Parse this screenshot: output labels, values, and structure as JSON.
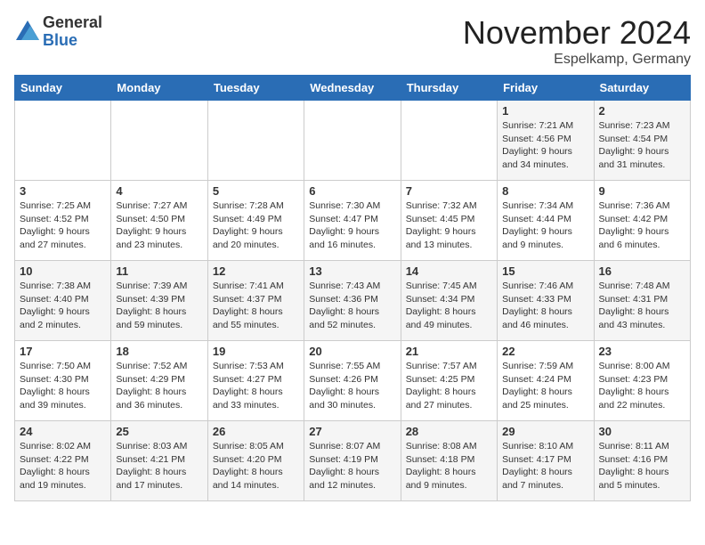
{
  "logo": {
    "general": "General",
    "blue": "Blue"
  },
  "title": "November 2024",
  "location": "Espelkamp, Germany",
  "headers": [
    "Sunday",
    "Monday",
    "Tuesday",
    "Wednesday",
    "Thursday",
    "Friday",
    "Saturday"
  ],
  "weeks": [
    [
      {
        "day": "",
        "info": ""
      },
      {
        "day": "",
        "info": ""
      },
      {
        "day": "",
        "info": ""
      },
      {
        "day": "",
        "info": ""
      },
      {
        "day": "",
        "info": ""
      },
      {
        "day": "1",
        "info": "Sunrise: 7:21 AM\nSunset: 4:56 PM\nDaylight: 9 hours\nand 34 minutes."
      },
      {
        "day": "2",
        "info": "Sunrise: 7:23 AM\nSunset: 4:54 PM\nDaylight: 9 hours\nand 31 minutes."
      }
    ],
    [
      {
        "day": "3",
        "info": "Sunrise: 7:25 AM\nSunset: 4:52 PM\nDaylight: 9 hours\nand 27 minutes."
      },
      {
        "day": "4",
        "info": "Sunrise: 7:27 AM\nSunset: 4:50 PM\nDaylight: 9 hours\nand 23 minutes."
      },
      {
        "day": "5",
        "info": "Sunrise: 7:28 AM\nSunset: 4:49 PM\nDaylight: 9 hours\nand 20 minutes."
      },
      {
        "day": "6",
        "info": "Sunrise: 7:30 AM\nSunset: 4:47 PM\nDaylight: 9 hours\nand 16 minutes."
      },
      {
        "day": "7",
        "info": "Sunrise: 7:32 AM\nSunset: 4:45 PM\nDaylight: 9 hours\nand 13 minutes."
      },
      {
        "day": "8",
        "info": "Sunrise: 7:34 AM\nSunset: 4:44 PM\nDaylight: 9 hours\nand 9 minutes."
      },
      {
        "day": "9",
        "info": "Sunrise: 7:36 AM\nSunset: 4:42 PM\nDaylight: 9 hours\nand 6 minutes."
      }
    ],
    [
      {
        "day": "10",
        "info": "Sunrise: 7:38 AM\nSunset: 4:40 PM\nDaylight: 9 hours\nand 2 minutes."
      },
      {
        "day": "11",
        "info": "Sunrise: 7:39 AM\nSunset: 4:39 PM\nDaylight: 8 hours\nand 59 minutes."
      },
      {
        "day": "12",
        "info": "Sunrise: 7:41 AM\nSunset: 4:37 PM\nDaylight: 8 hours\nand 55 minutes."
      },
      {
        "day": "13",
        "info": "Sunrise: 7:43 AM\nSunset: 4:36 PM\nDaylight: 8 hours\nand 52 minutes."
      },
      {
        "day": "14",
        "info": "Sunrise: 7:45 AM\nSunset: 4:34 PM\nDaylight: 8 hours\nand 49 minutes."
      },
      {
        "day": "15",
        "info": "Sunrise: 7:46 AM\nSunset: 4:33 PM\nDaylight: 8 hours\nand 46 minutes."
      },
      {
        "day": "16",
        "info": "Sunrise: 7:48 AM\nSunset: 4:31 PM\nDaylight: 8 hours\nand 43 minutes."
      }
    ],
    [
      {
        "day": "17",
        "info": "Sunrise: 7:50 AM\nSunset: 4:30 PM\nDaylight: 8 hours\nand 39 minutes."
      },
      {
        "day": "18",
        "info": "Sunrise: 7:52 AM\nSunset: 4:29 PM\nDaylight: 8 hours\nand 36 minutes."
      },
      {
        "day": "19",
        "info": "Sunrise: 7:53 AM\nSunset: 4:27 PM\nDaylight: 8 hours\nand 33 minutes."
      },
      {
        "day": "20",
        "info": "Sunrise: 7:55 AM\nSunset: 4:26 PM\nDaylight: 8 hours\nand 30 minutes."
      },
      {
        "day": "21",
        "info": "Sunrise: 7:57 AM\nSunset: 4:25 PM\nDaylight: 8 hours\nand 27 minutes."
      },
      {
        "day": "22",
        "info": "Sunrise: 7:59 AM\nSunset: 4:24 PM\nDaylight: 8 hours\nand 25 minutes."
      },
      {
        "day": "23",
        "info": "Sunrise: 8:00 AM\nSunset: 4:23 PM\nDaylight: 8 hours\nand 22 minutes."
      }
    ],
    [
      {
        "day": "24",
        "info": "Sunrise: 8:02 AM\nSunset: 4:22 PM\nDaylight: 8 hours\nand 19 minutes."
      },
      {
        "day": "25",
        "info": "Sunrise: 8:03 AM\nSunset: 4:21 PM\nDaylight: 8 hours\nand 17 minutes."
      },
      {
        "day": "26",
        "info": "Sunrise: 8:05 AM\nSunset: 4:20 PM\nDaylight: 8 hours\nand 14 minutes."
      },
      {
        "day": "27",
        "info": "Sunrise: 8:07 AM\nSunset: 4:19 PM\nDaylight: 8 hours\nand 12 minutes."
      },
      {
        "day": "28",
        "info": "Sunrise: 8:08 AM\nSunset: 4:18 PM\nDaylight: 8 hours\nand 9 minutes."
      },
      {
        "day": "29",
        "info": "Sunrise: 8:10 AM\nSunset: 4:17 PM\nDaylight: 8 hours\nand 7 minutes."
      },
      {
        "day": "30",
        "info": "Sunrise: 8:11 AM\nSunset: 4:16 PM\nDaylight: 8 hours\nand 5 minutes."
      }
    ]
  ]
}
